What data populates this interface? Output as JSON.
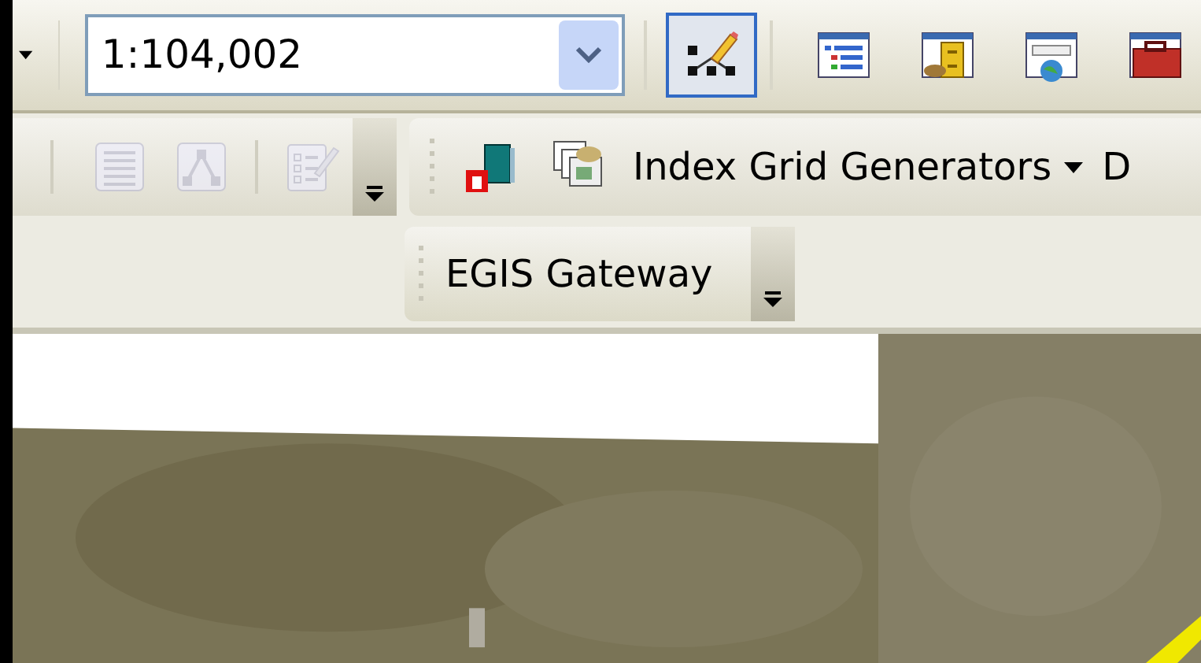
{
  "scale_toolbar": {
    "scale": "1:104,002",
    "tools": [
      {
        "kind": "edit",
        "selected": true
      },
      {
        "kind": "list",
        "selected": false
      },
      {
        "kind": "catalog",
        "selected": false
      },
      {
        "kind": "window",
        "selected": false
      },
      {
        "kind": "toolbox",
        "selected": false
      }
    ]
  },
  "editor_toolbar": {
    "tools": [
      {
        "kind": "table",
        "disabled": true
      },
      {
        "kind": "vertex",
        "disabled": true
      },
      {
        "kind": "attributes",
        "disabled": true
      }
    ]
  },
  "index_toolbar": {
    "tools": [
      {
        "kind": "book"
      },
      {
        "kind": "layers"
      }
    ],
    "menu": "Index Grid Generators",
    "next_label": "D"
  },
  "egis_toolbar": {
    "label": "EGIS Gateway"
  }
}
